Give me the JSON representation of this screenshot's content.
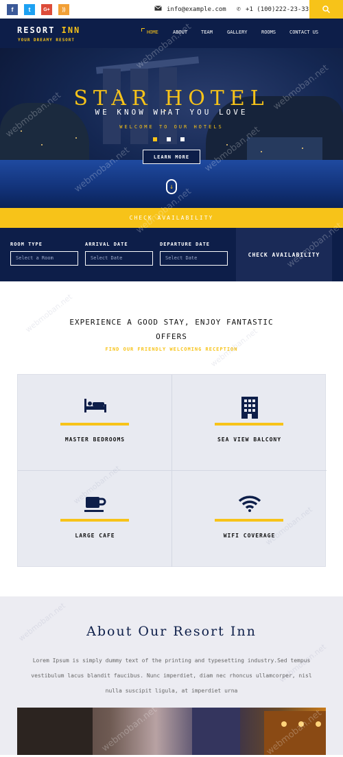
{
  "topbar": {
    "social": [
      {
        "icon": "facebook-icon",
        "glyph": "f",
        "color": "#3b5998"
      },
      {
        "icon": "twitter-icon",
        "glyph": "t",
        "color": "#1da1f2"
      },
      {
        "icon": "google-plus-icon",
        "glyph": "G+",
        "color": "#dd4b39"
      },
      {
        "icon": "rss-icon",
        "glyph": "))",
        "color": "#f2a036"
      }
    ],
    "email": "info@example.com",
    "phone": "+1 (100)222-23-33"
  },
  "nav": {
    "brand_a": "RESORT",
    "brand_b": "INN",
    "tagline": "YOUR DREAMY RESORT",
    "items": [
      "HOME",
      "ABOUT",
      "TEAM",
      "GALLERY",
      "ROOMS",
      "CONTACT US"
    ],
    "active": "HOME"
  },
  "hero": {
    "title": "STAR HOTEL",
    "subtitle": "WE KNOW WHAT YOU LOVE",
    "welcome": "WELCOME TO OUR HOTELS",
    "button": "LEARN MORE"
  },
  "availability": {
    "bar_label": "CHECK AVAILABILITY",
    "fields": [
      {
        "label": "ROOM TYPE",
        "placeholder": "Select a Room"
      },
      {
        "label": "ARRIVAL DATE",
        "placeholder": "Select Date"
      },
      {
        "label": "DEPARTURE DATE",
        "placeholder": "Select Date"
      }
    ],
    "button": "CHECK AVAILABILITY"
  },
  "experience": {
    "title_line1": "EXPERIENCE A GOOD STAY, ENJOY FANTASTIC",
    "title_line2": "OFFERS",
    "subtitle": "FIND OUR FRIENDLY WELCOMING RECEPTION"
  },
  "features": [
    {
      "icon": "bed-icon",
      "label": "MASTER BEDROOMS"
    },
    {
      "icon": "building-icon",
      "label": "SEA VIEW BALCONY"
    },
    {
      "icon": "coffee-cup-icon",
      "label": "LARGE CAFE"
    },
    {
      "icon": "wifi-icon",
      "label": "WIFI COVERAGE"
    }
  ],
  "about": {
    "title": "About Our Resort Inn",
    "text_line1": "Lorem Ipsum is simply dummy text of the printing and typesetting industry.Sed tempus",
    "text_line2": "vestibulum lacus blandit faucibus. Nunc imperdiet, diam nec rhoncus ullamcorper, nisl",
    "text_line3": "nulla suscipit ligula, at imperdiet urna"
  },
  "watermark": "webmoban.net",
  "colors": {
    "navy": "#0d1e49",
    "gold": "#f7c319"
  }
}
